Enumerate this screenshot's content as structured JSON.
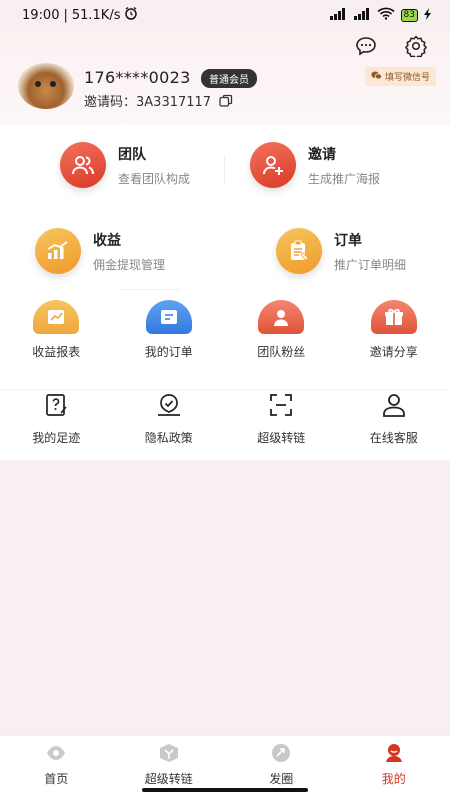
{
  "status": {
    "time": "19:00",
    "speed": "51.1K/s",
    "battery": "83"
  },
  "profile": {
    "phone": "176****0023",
    "member_level": "普通会员",
    "invite_label": "邀请码：",
    "invite_code": "3A3317117",
    "wechat_button": "填写微信号"
  },
  "primary": [
    {
      "title": "团队",
      "subtitle": "查看团队构成",
      "icon": "team-icon"
    },
    {
      "title": "邀请",
      "subtitle": "生成推广海报",
      "icon": "invite-user-icon"
    },
    {
      "title": "收益",
      "subtitle": "佣金提现管理",
      "icon": "earnings-chart-icon"
    },
    {
      "title": "订单",
      "subtitle": "推广订单明细",
      "icon": "order-clipboard-icon"
    }
  ],
  "shortcuts": [
    {
      "label": "收益报表",
      "icon": "earnings-report-icon"
    },
    {
      "label": "我的订单",
      "icon": "my-orders-icon"
    },
    {
      "label": "团队粉丝",
      "icon": "team-fans-icon"
    },
    {
      "label": "邀请分享",
      "icon": "gift-share-icon"
    }
  ],
  "tools": [
    {
      "label": "我的足迹",
      "icon": "footprint-icon"
    },
    {
      "label": "隐私政策",
      "icon": "privacy-shield-icon"
    },
    {
      "label": "超级转链",
      "icon": "scan-frame-icon"
    },
    {
      "label": "在线客服",
      "icon": "customer-service-icon"
    }
  ],
  "tabs": [
    {
      "label": "首页",
      "icon": "home-icon"
    },
    {
      "label": "超级转链",
      "icon": "super-link-icon"
    },
    {
      "label": "发圈",
      "icon": "share-circle-icon"
    },
    {
      "label": "我的",
      "icon": "profile-icon"
    }
  ],
  "colors": {
    "accent": "#d4361f",
    "orange": "#f2a43a",
    "blue": "#3d8fe8"
  }
}
